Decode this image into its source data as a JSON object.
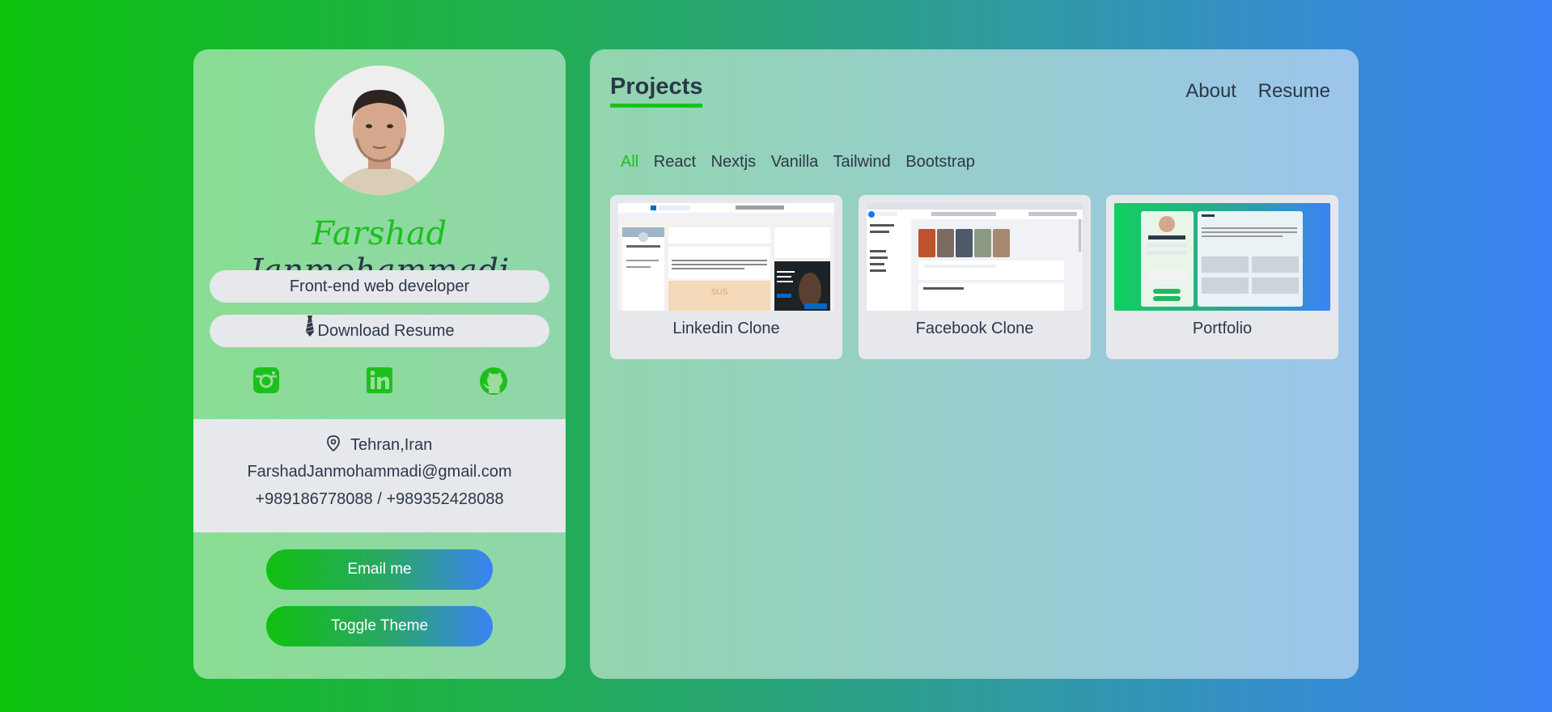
{
  "profile": {
    "first_name": "Farshad",
    "last_name": "Janmohammadi",
    "role": "Front-end web developer",
    "download_label": "Download Resume",
    "location": "Tehran,Iran",
    "email": "FarshadJanmohammadi@gmail.com",
    "phone": "+989186778088 / +989352428088",
    "email_button": "Email me",
    "theme_button": "Toggle Theme",
    "socials": [
      "instagram-icon",
      "linkedin-icon",
      "github-icon"
    ]
  },
  "projects": {
    "title": "Projects",
    "nav": [
      "About",
      "Resume"
    ],
    "filters": [
      "All",
      "React",
      "Nextjs",
      "Vanilla",
      "Tailwind",
      "Bootstrap"
    ],
    "active_filter": "All",
    "items": [
      {
        "label": "Linkedin Clone"
      },
      {
        "label": "Facebook Clone"
      },
      {
        "label": "Portfolio"
      }
    ]
  },
  "colors": {
    "accent_green": "#1cc01c",
    "accent_blue": "#3b82f6",
    "text_dark": "#2d3748",
    "light_gray": "#e6e8ec"
  }
}
